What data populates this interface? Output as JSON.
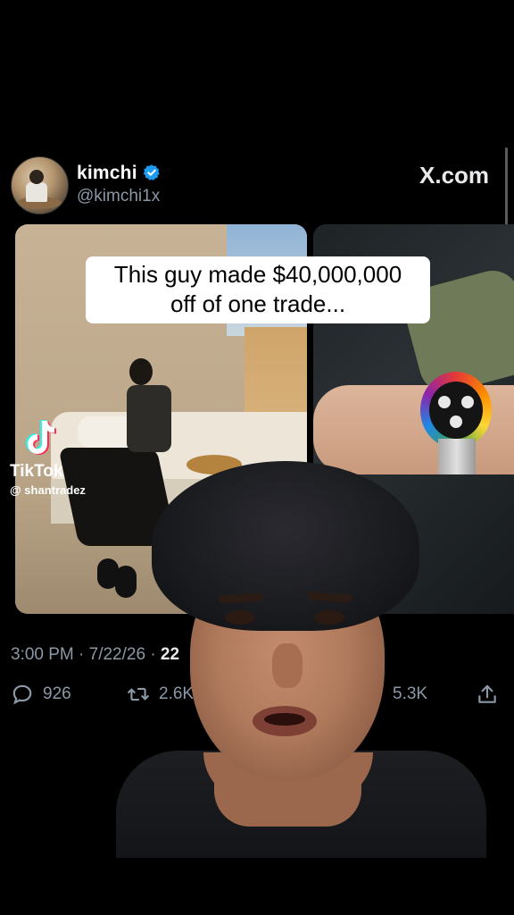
{
  "post": {
    "author_name": "kimchi",
    "author_handle": "@kimchi1x",
    "verified": true,
    "source": "X.com",
    "timestamp": "3:00 PM · 7/22/26 · ",
    "views_partial": "22"
  },
  "caption": {
    "line1": "This guy made $40,000,000",
    "line2": "off of one trade..."
  },
  "watermark": {
    "app": "TikTok",
    "user": "@ shantradez"
  },
  "actions": {
    "replies": "926",
    "reposts": "2.6K",
    "bookmarks": "5.3K"
  },
  "icons": [
    "verified-badge-icon",
    "tiktok-logo-icon",
    "reply-icon",
    "repost-icon",
    "bookmark-icon",
    "share-icon"
  ],
  "colors": {
    "background": "#000000",
    "muted_text": "#8b98a5",
    "verified_blue": "#1d9bf0"
  }
}
